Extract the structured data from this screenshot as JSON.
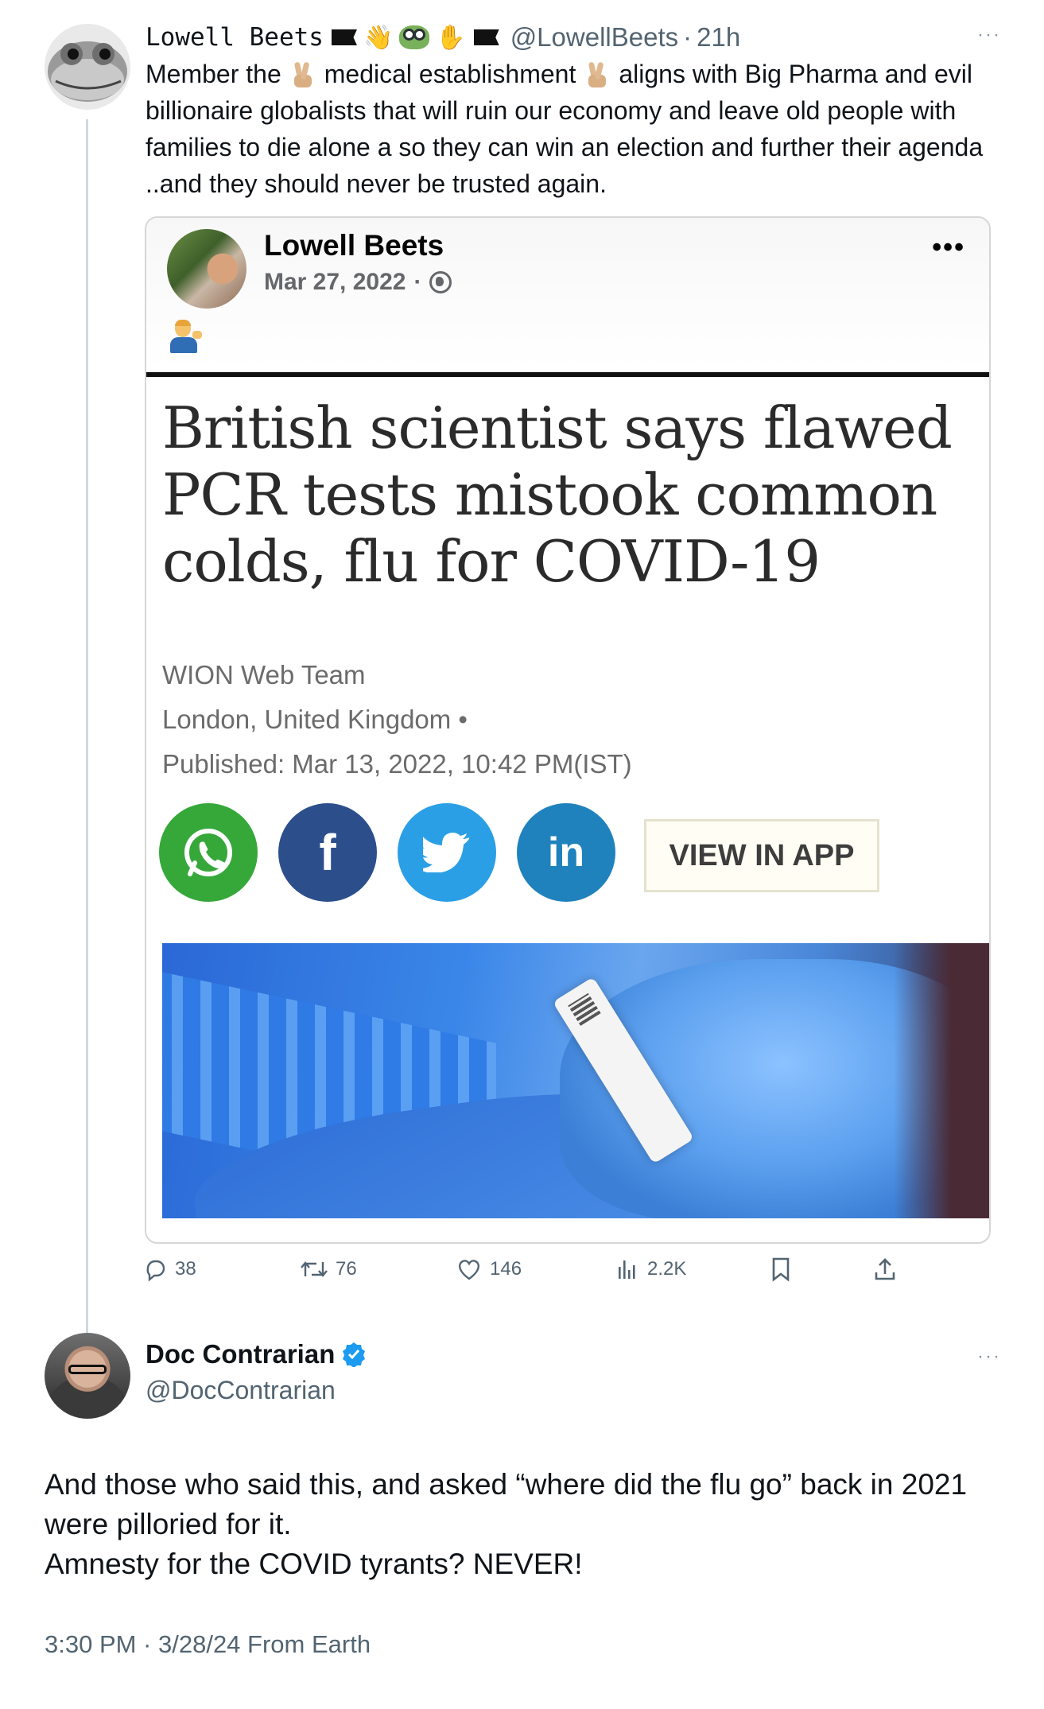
{
  "quoted_tweet": {
    "author_name": "Lowell Beets",
    "handle": "@LowellBeets",
    "separator": "·",
    "age": "21h",
    "more": "···",
    "text_parts": [
      "Member the",
      "medical establishment",
      "aligns with Big Pharma and evil billionaire globalists that will ruin our economy and leave old people with families to die alone a so they can win an election and further their agenda ..and they should never be trusted again."
    ],
    "actions": {
      "replies": "38",
      "retweets": "76",
      "likes": "146",
      "views": "2.2K"
    }
  },
  "facebook_post": {
    "author_name": "Lowell Beets",
    "date": "Mar 27, 2022",
    "separator": "·",
    "more": "•••",
    "article": {
      "headline": "British scientist says flawed PCR tests mistook common colds, flu for COVID-19",
      "author": "WION Web Team",
      "location": "London, United Kingdom •",
      "published": "Published: Mar 13, 2022, 10:42 PM(IST)",
      "view_in_app": "VIEW IN APP",
      "facebook_glyph": "f",
      "linkedin_glyph": "in"
    }
  },
  "main_tweet": {
    "author_name": "Doc Contrarian",
    "handle": "@DocContrarian",
    "more": "···",
    "text_line1": "And those who said this, and asked “where did the flu go” back in 2021 were pilloried for it.",
    "text_line2": "Amnesty for the COVID tyrants? NEVER!",
    "meta": "3:30 PM · 3/28/24 From Earth"
  },
  "colors": {
    "verified": "#1d9bf0",
    "secondary_text": "#536471",
    "whatsapp": "#36a83a",
    "facebook": "#2c4f8c",
    "twitter": "#2b9fe6",
    "linkedin": "#1f82bd"
  }
}
